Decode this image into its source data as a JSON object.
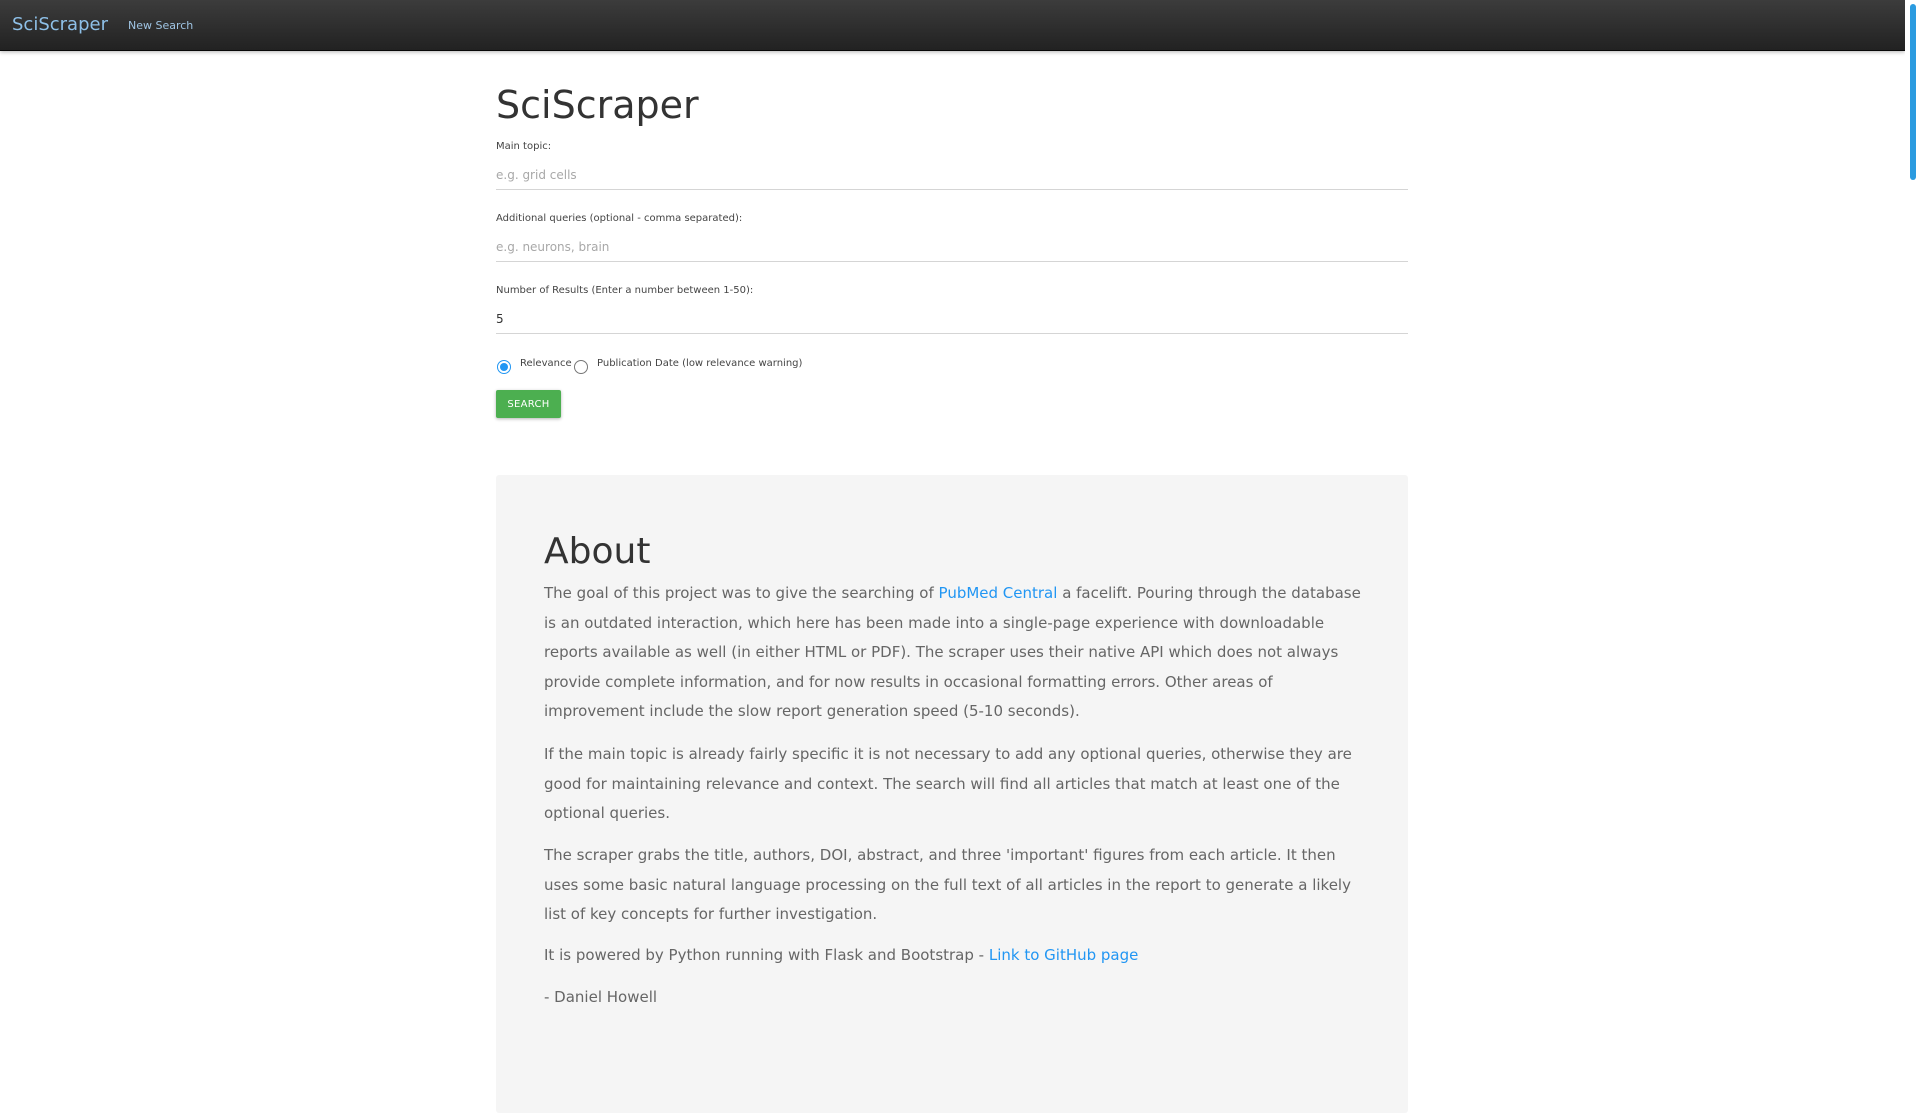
{
  "navbar": {
    "brand": "SciScraper",
    "new_search": "New Search"
  },
  "form": {
    "title": "SciScraper",
    "main_topic": {
      "label": "Main topic:",
      "placeholder": "e.g. grid cells",
      "value": ""
    },
    "additional": {
      "label": "Additional queries (optional - comma separated):",
      "placeholder": "e.g. neurons, brain",
      "value": ""
    },
    "num_results": {
      "label": "Number of Results (Enter a number between 1-50):",
      "value": "5"
    },
    "sort_options": [
      {
        "label": "Relevance",
        "selected": true
      },
      {
        "label": "Publication Date (low relevance warning)",
        "selected": false
      }
    ],
    "search_button": "SEARCH"
  },
  "about": {
    "title": "About",
    "p1_before": "The goal of this project was to give the searching of ",
    "p1_link": "PubMed Central",
    "p1_after": " a facelift. Pouring through the database is an outdated interaction, which here has been made into a single-page experience with downloadable reports available as well (in either HTML or PDF). The scraper uses their native API which does not always provide complete information, and for now results in occasional formatting errors. Other areas of improvement include the slow report generation speed (5-10 seconds).",
    "p2": "If the main topic is already fairly specific it is not necessary to add any optional queries, otherwise they are good for maintaining relevance and context. The search will find all articles that match at least one of the optional queries.",
    "p3": "The scraper grabs the title, authors, DOI, abstract, and three 'important' figures from each article. It then uses some basic natural language processing on the full text of all articles in the report to generate a likely list of key concepts for further investigation.",
    "p4_before": "It is powered by Python running with Flask and Bootstrap - ",
    "p4_link": "Link to GitHub page",
    "signature": "- Daniel Howell"
  },
  "colors": {
    "navbar_bg": "#2b2b2b",
    "accent": "#2196f3",
    "search_button": "#4caf50",
    "about_bg": "#f5f5f5"
  }
}
